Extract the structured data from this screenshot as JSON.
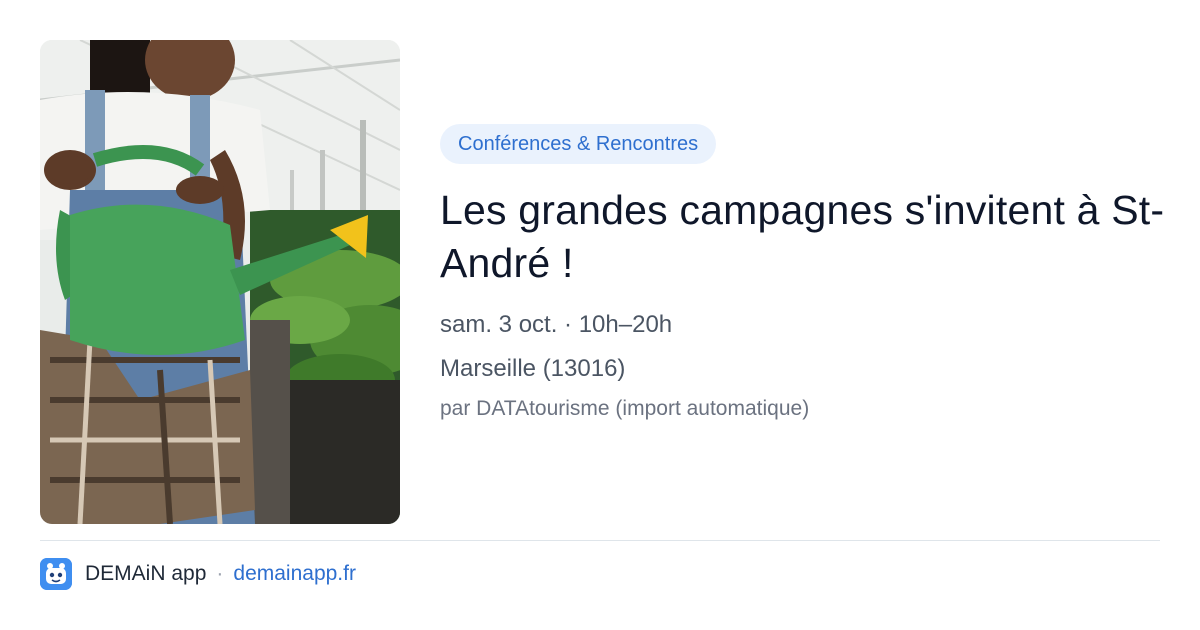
{
  "event": {
    "category": "Conférences & Rencontres",
    "title": "Les grandes campagnes s'invitent à St-André !",
    "date": "sam. 3 oct. · 10h–20h",
    "location": "Marseille (13016)",
    "source": "par DATAtourisme (import automatique)",
    "image_icon": "greenhouse-watering-photo"
  },
  "footer": {
    "app_name": "DEMAiN app",
    "separator": "·",
    "site": "demainapp.fr",
    "app_icon": "demain-app-icon"
  },
  "colors": {
    "accent": "#2e6fcf",
    "chip_background": "#eaf2fd",
    "app_icon": "#3f8ef0"
  }
}
